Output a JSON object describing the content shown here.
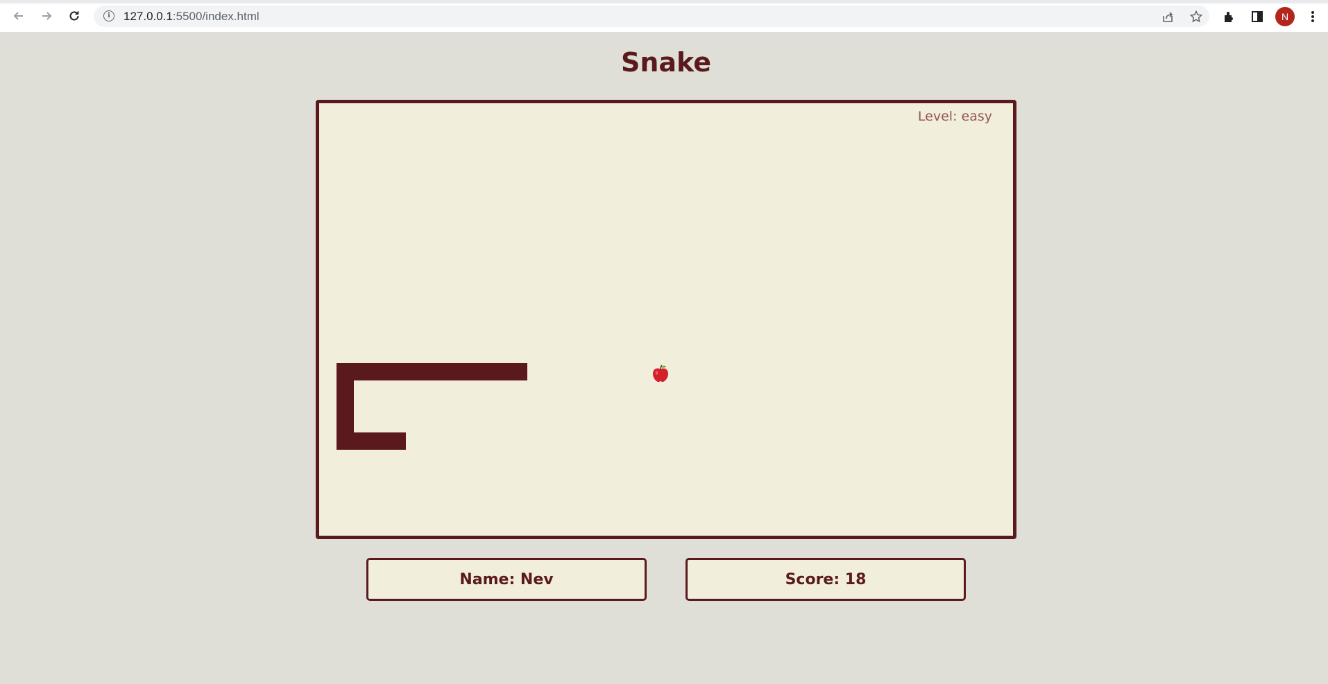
{
  "browser": {
    "url_host": "127.0.0.1",
    "url_rest": ":5500/index.html",
    "avatar_initial": "N",
    "icons": [
      "back-icon",
      "forward-icon",
      "reload-icon",
      "site-info-icon",
      "share-icon",
      "star-icon",
      "extensions-icon",
      "side-panel-icon",
      "menu-icon"
    ]
  },
  "game": {
    "title": "Snake",
    "level_text": "Level: easy",
    "name_text": "Name: Nev",
    "score_text": "Score: 18",
    "food": "apple-icon"
  },
  "colors": {
    "page_bg": "#e0dfd7",
    "board_bg": "#f2eedc",
    "accent": "#5a1a1d",
    "level_text": "#94565a",
    "apple": "#d4202a"
  }
}
